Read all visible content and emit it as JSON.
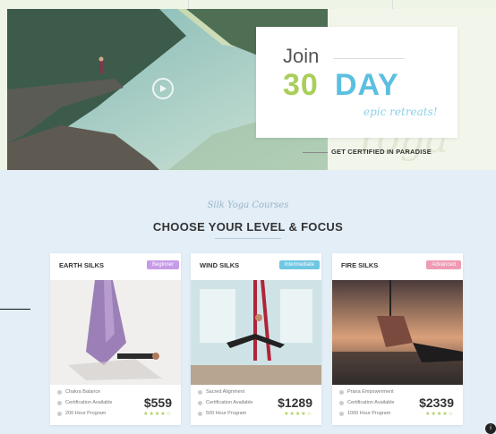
{
  "hero": {
    "join_word": "Join",
    "number": "30",
    "day": "DAY",
    "script_tagline": "epic retreats!",
    "certified": "GET CERTIFIED IN PARADISE",
    "background_script": "Yoga"
  },
  "section": {
    "script_title": "Silk Yoga Courses",
    "title": "CHOOSE YOUR LEVEL & FOCUS"
  },
  "courses": [
    {
      "name": "EARTH SILKS",
      "badge": "Beginner",
      "badge_color": "#c79be8",
      "features": [
        "Chakra Balance",
        "Certification Available",
        "200 Hour Program"
      ],
      "price": "$559",
      "rating": "★★★★☆"
    },
    {
      "name": "WIND SILKS",
      "badge": "Intermediate",
      "badge_color": "#6fc7e2",
      "features": [
        "Sacred Alignment",
        "Certification Available",
        "500 Hour Program"
      ],
      "price": "$1289",
      "rating": "★★★★☆"
    },
    {
      "name": "FIRE SILKS",
      "badge": "Advanced",
      "badge_color": "#ef9bb4",
      "features": [
        "Prana Empowerment",
        "Certification Available",
        "1000 Hour Program"
      ],
      "price": "$2339",
      "rating": "★★★★☆"
    }
  ],
  "colors": {
    "accent_green": "#a9cf5a",
    "accent_blue": "#5bbfe0",
    "section_bg": "#e3eef7"
  }
}
